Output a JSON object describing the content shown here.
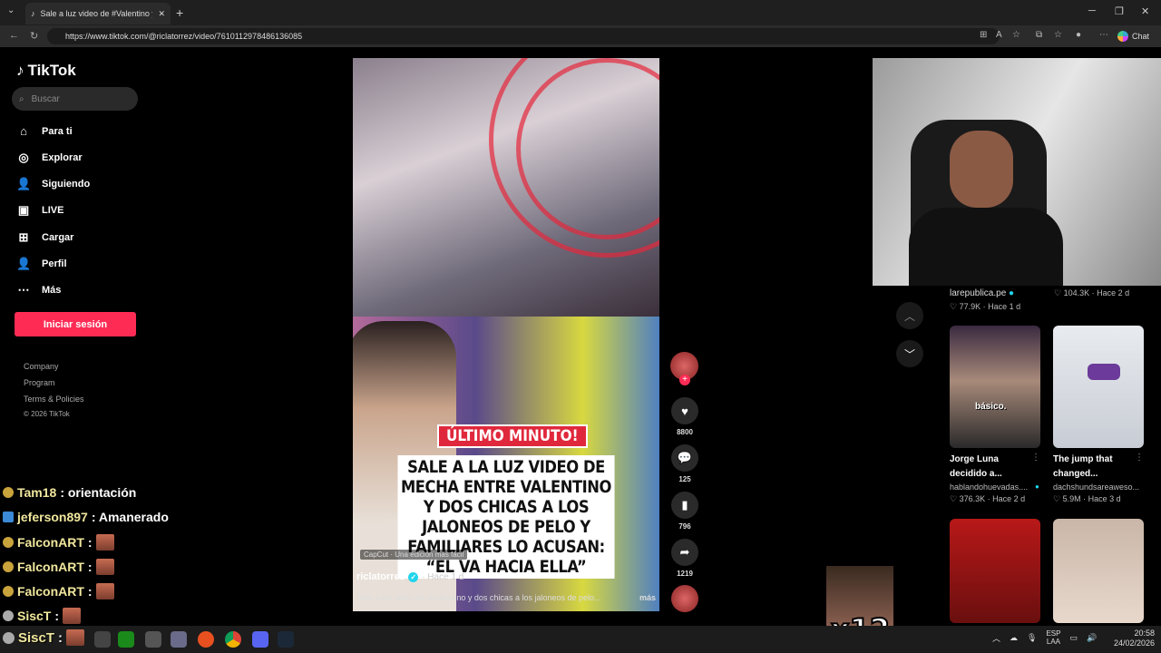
{
  "browser": {
    "tab_title": "Sale a luz video de #Valentino y d...",
    "url": "https://www.tiktok.com/@riclatorrez/video/7610112978486136085",
    "chat_label": "Chat"
  },
  "sidebar": {
    "logo": "TikTok",
    "search_placeholder": "Buscar",
    "items": [
      {
        "label": "Para ti",
        "icon": "home-icon"
      },
      {
        "label": "Explorar",
        "icon": "compass-icon"
      },
      {
        "label": "Siguiendo",
        "icon": "following-icon"
      },
      {
        "label": "LIVE",
        "icon": "live-icon"
      },
      {
        "label": "Cargar",
        "icon": "upload-icon"
      },
      {
        "label": "Perfil",
        "icon": "profile-icon"
      },
      {
        "label": "Más",
        "icon": "more-icon"
      }
    ],
    "login": "Iniciar sesión",
    "footer": [
      "Company",
      "Program",
      "Terms & Policies",
      "© 2026 TikTok"
    ]
  },
  "chat": [
    {
      "user": "Tam18",
      "msg": ": orientación"
    },
    {
      "user": "jeferson897",
      "msg": ": Amanerado"
    },
    {
      "user": "FalconART",
      "msg": ":"
    },
    {
      "user": "FalconART",
      "msg": ":"
    },
    {
      "user": "FalconART",
      "msg": ":"
    },
    {
      "user": "SiscT",
      "msg": ":"
    },
    {
      "user": "SiscT",
      "msg": ":"
    }
  ],
  "video": {
    "badge": "ÚLTIMO MINUTO!",
    "headline": "SALE A LA LUZ VIDEO DE MECHA ENTRE VALENTINO Y DOS CHICAS A LOS JALONEOS DE PELO Y FAMILIARES LO ACUSAN: “EL VA HACIA ELLA”",
    "capcut": "CapCut · Una edición más fácil",
    "author": "riclatorrez",
    "when": "· Hace 1 d",
    "description": "Sale a luz video de #Valentino y dos chicas a los jaloneos de pelo...",
    "more": "más"
  },
  "actions": {
    "likes": "8800",
    "comments": "125",
    "saves": "796",
    "shares": "1219"
  },
  "recommendations": [
    {
      "author": "larepublica.pe",
      "likes": "77.9K",
      "when": "Hace 1 d"
    },
    {
      "author": "",
      "likes": "104.3K",
      "when": "Hace 2 d"
    },
    {
      "title": "Jorge Luna decidido a...",
      "author": "hablandohuevadas....",
      "likes": "376.3K",
      "when": "Hace 2 d",
      "caption": "básico."
    },
    {
      "title": "The jump that changed...",
      "author": "dachshundsareaweso...",
      "likes": "5.9M",
      "when": "Hace 3 d"
    }
  ],
  "overlay": {
    "multiplier": "x12"
  },
  "taskbar": {
    "lang": "ESP",
    "lang2": "LAA",
    "time": "20:58",
    "date": "24/02/2026"
  }
}
